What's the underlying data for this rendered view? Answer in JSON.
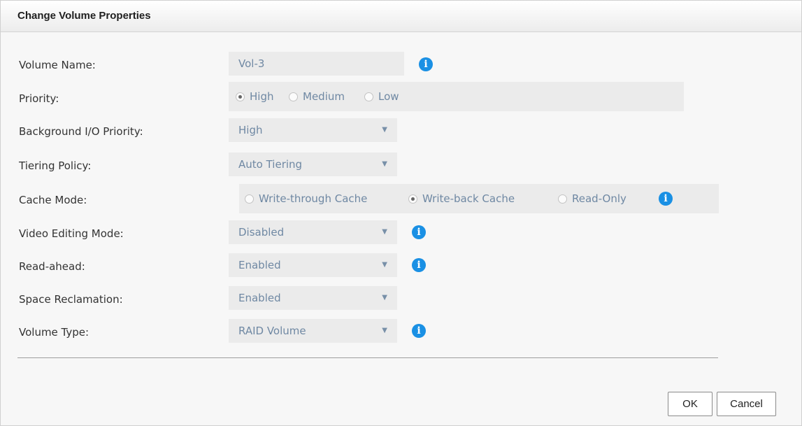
{
  "dialog": {
    "title": "Change Volume Properties"
  },
  "labels": {
    "volume_name": "Volume Name:",
    "priority": "Priority:",
    "bg_io_priority": "Background I/O Priority:",
    "tiering_policy": "Tiering Policy:",
    "cache_mode": "Cache Mode:",
    "video_editing": "Video Editing Mode:",
    "read_ahead": "Read-ahead:",
    "space_reclamation": "Space Reclamation:",
    "volume_type": "Volume Type:"
  },
  "fields": {
    "volume_name": {
      "value": "Vol-3"
    },
    "priority": {
      "options": [
        {
          "label": "High",
          "checked": true
        },
        {
          "label": "Medium",
          "checked": false
        },
        {
          "label": "Low",
          "checked": false
        }
      ]
    },
    "bg_io_priority": {
      "value": "High"
    },
    "tiering_policy": {
      "value": "Auto Tiering"
    },
    "cache_mode": {
      "options": [
        {
          "label": "Write-through Cache",
          "checked": false
        },
        {
          "label": "Write-back Cache",
          "checked": true
        },
        {
          "label": "Read-Only",
          "checked": false
        }
      ]
    },
    "video_editing": {
      "value": "Disabled"
    },
    "read_ahead": {
      "value": "Enabled"
    },
    "space_reclamation": {
      "value": "Enabled"
    },
    "volume_type": {
      "value": "RAID Volume"
    }
  },
  "icons": {
    "info": "info-icon",
    "dropdown": "triangle-down-icon"
  },
  "colors": {
    "info_icon": "#1a90e4",
    "field_text": "#6f88a3",
    "field_bg": "#ebebeb"
  },
  "info_glyph": "i",
  "dropdown_glyph": "▼",
  "buttons": {
    "ok": "OK",
    "cancel": "Cancel"
  }
}
